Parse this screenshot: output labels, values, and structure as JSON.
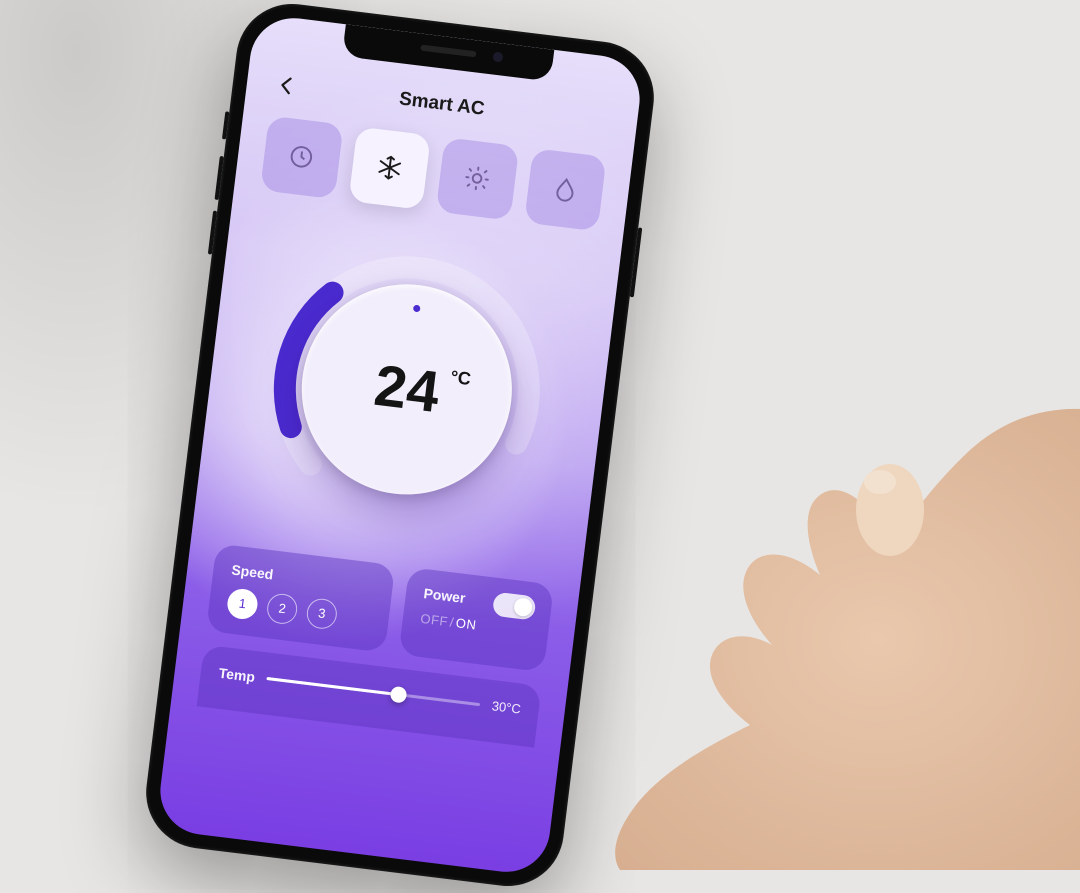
{
  "header": {
    "title": "Smart AC",
    "back_icon": "arrow-left"
  },
  "modes": [
    {
      "id": "timer",
      "icon": "clock-icon",
      "active": false
    },
    {
      "id": "cool",
      "icon": "snowflake-icon",
      "active": true
    },
    {
      "id": "sun",
      "icon": "sun-icon",
      "active": false
    },
    {
      "id": "humidity",
      "icon": "droplet-icon",
      "active": false
    }
  ],
  "dial": {
    "value": "24",
    "unit": "°C"
  },
  "speed": {
    "label": "Speed",
    "options": [
      "1",
      "2",
      "3"
    ],
    "selected": "1"
  },
  "power": {
    "label": "Power",
    "off_label": "OFF",
    "on_label": "ON",
    "separator": "/",
    "state": "on"
  },
  "temp_slider": {
    "label": "Temp",
    "max_label": "30°C",
    "percent": 62
  },
  "colors": {
    "accent": "#4a2bcf",
    "bg_top": "#e6defa",
    "bg_bottom": "#7a3ee3"
  }
}
